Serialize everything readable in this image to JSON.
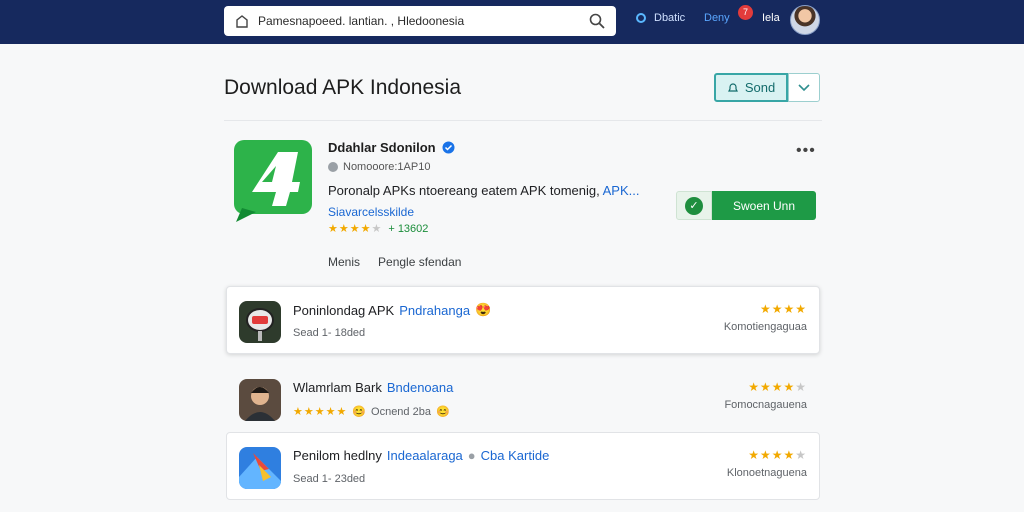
{
  "topbar": {
    "search_text": "Pamesnapoeed. lantian. , Hledoonesia",
    "item1": "Dbatic",
    "item2": "Deny",
    "badge": "7",
    "user": "Iela"
  },
  "page": {
    "title": "Download APK Indonesia",
    "send_label": "Sond"
  },
  "app": {
    "name": "Ddahlar Sdonilon",
    "developer": "Nomooore:1AP10",
    "description": "Poronalp  APKs ntoereang eatem APK  tomenig, ",
    "description_link": "APK...",
    "more_link": "Siavarcelsskilde",
    "rating_count": "13602",
    "install_label": "Swoen Unn",
    "tab1": "Menis",
    "tab2": "Pengle sfendan",
    "icon_colors": {
      "green": "#2db34a",
      "dark": "#128a33"
    }
  },
  "list": [
    {
      "title": "Poninlondag APK",
      "highlight": "Pndrahanga",
      "sub": "Sead 1- 18ded",
      "meta": "Komotiengaguaa",
      "stars_on": 4
    },
    {
      "title": "Wlamrlam Bark",
      "highlight": "Bndenoana",
      "sub": "Ocnend 2ba",
      "meta": "Fomocnagauena",
      "stars_on": 4
    },
    {
      "title": "Penilom hedlny",
      "highlight": "Indeaalaraga",
      "extra": "Cba Kartide",
      "sub": "Sead 1- 23ded",
      "meta": "Klonoetnaguena",
      "stars_on": 4
    }
  ]
}
